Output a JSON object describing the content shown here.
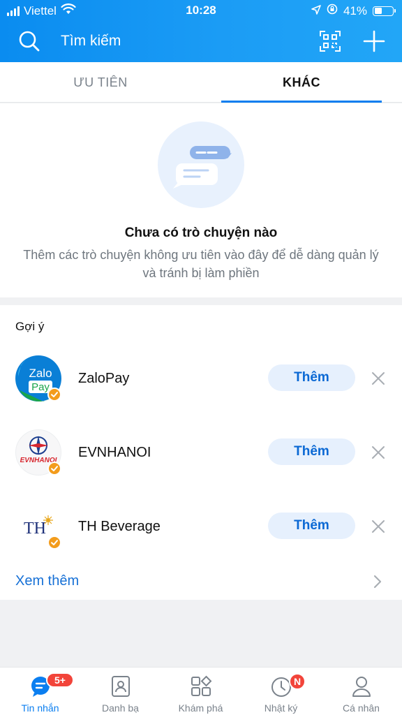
{
  "status_bar": {
    "carrier": "Viettel",
    "time": "10:28",
    "battery": "41%",
    "battery_level": 0.41
  },
  "header": {
    "search_placeholder": "Tìm kiếm",
    "icons": [
      "search-icon",
      "qr-scan-icon",
      "plus-icon"
    ]
  },
  "tabs": [
    {
      "label": "ƯU TIÊN",
      "active": false
    },
    {
      "label": "KHÁC",
      "active": true
    }
  ],
  "empty_state": {
    "title": "Chưa có trò chuyện nào",
    "description": "Thêm các trò chuyện không ưu tiên vào đây để dễ dàng quản lý và tránh bị làm phiền"
  },
  "suggestions": {
    "title": "Gợi ý",
    "items": [
      {
        "name": "ZaloPay",
        "button": "Thêm",
        "logo_lines": [
          "Zalo",
          "Pay"
        ]
      },
      {
        "name": "EVNHANOI",
        "button": "Thêm",
        "logo_text": "EVNHANOI"
      },
      {
        "name": "TH Beverage",
        "button": "Thêm",
        "logo_text": "TH"
      }
    ],
    "see_more": "Xem thêm"
  },
  "bottom_nav": [
    {
      "label": "Tin nhắn",
      "icon": "chat-icon",
      "active": true,
      "badge": "5+"
    },
    {
      "label": "Danh bạ",
      "icon": "contacts-icon",
      "active": false
    },
    {
      "label": "Khám phá",
      "icon": "grid-icon",
      "active": false
    },
    {
      "label": "Nhật ký",
      "icon": "clock-icon",
      "active": false,
      "badge": "N"
    },
    {
      "label": "Cá nhân",
      "icon": "person-icon",
      "active": false
    }
  ],
  "colors": {
    "header_gradient_start": "#0a8cf0",
    "header_gradient_end": "#22a6f7",
    "accent": "#0a7ef0",
    "button_bg": "#e6f0fd",
    "verified": "#f39c1c",
    "badge": "#f2443a"
  }
}
